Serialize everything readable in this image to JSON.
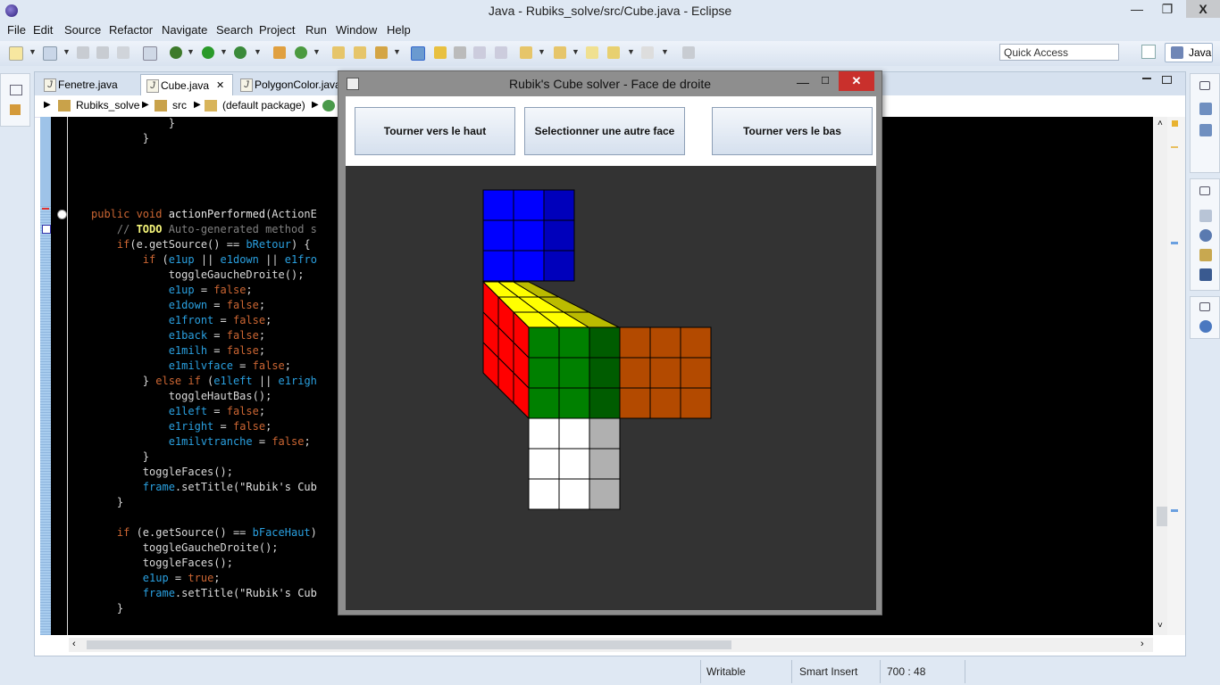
{
  "window": {
    "title": "Java - Rubiks_solve/src/Cube.java - Eclipse",
    "minimize": "—",
    "restore": "❐",
    "close": "X"
  },
  "menu": [
    "File",
    "Edit",
    "Source",
    "Refactor",
    "Navigate",
    "Search",
    "Project",
    "Run",
    "Window",
    "Help"
  ],
  "toolbar": {
    "quick_access": "Quick Access",
    "perspective": "Java"
  },
  "editor": {
    "tabs": [
      "Fenetre.java",
      "Cube.java",
      "PolygonColor.java"
    ],
    "active_tab": 1,
    "tab_close": "✕",
    "breadcrumb": [
      "Rubiks_solve",
      "src",
      "(default package)"
    ],
    "code_lines": [
      {
        "t": [
          [
            "            }",
            ""
          ]
        ]
      },
      {
        "t": [
          [
            "        }",
            ""
          ]
        ]
      },
      {
        "t": [
          [
            "",
            ""
          ]
        ]
      },
      {
        "t": [
          [
            "",
            ""
          ]
        ]
      },
      {
        "t": [
          [
            "",
            ""
          ]
        ]
      },
      {
        "t": [
          [
            "",
            ""
          ]
        ]
      },
      {
        "t": [
          [
            "public void ",
            "kw"
          ],
          [
            "actionPerformed",
            "fn"
          ],
          [
            "(ActionE",
            ""
          ]
        ]
      },
      {
        "t": [
          [
            "    // ",
            "cm"
          ],
          [
            "TODO",
            "todo"
          ],
          [
            " Auto-generated method s",
            "cm"
          ]
        ]
      },
      {
        "t": [
          [
            "    if",
            "kw"
          ],
          [
            "(e.getSource() == ",
            ""
          ],
          [
            "bRetour",
            "fld"
          ],
          [
            ") {",
            ""
          ]
        ]
      },
      {
        "t": [
          [
            "        if ",
            "kw"
          ],
          [
            "(",
            ""
          ],
          [
            "e1up",
            "fld"
          ],
          [
            " || ",
            ""
          ],
          [
            "e1down",
            "fld"
          ],
          [
            " || ",
            ""
          ],
          [
            "e1fro",
            "fld"
          ]
        ]
      },
      {
        "t": [
          [
            "            toggleGaucheDroite();",
            ""
          ]
        ]
      },
      {
        "t": [
          [
            "            ",
            ""
          ],
          [
            "e1up",
            "fld"
          ],
          [
            " = ",
            ""
          ],
          [
            "false",
            "kw"
          ],
          [
            ";",
            ""
          ]
        ]
      },
      {
        "t": [
          [
            "            ",
            ""
          ],
          [
            "e1down",
            "fld"
          ],
          [
            " = ",
            ""
          ],
          [
            "false",
            "kw"
          ],
          [
            ";",
            ""
          ]
        ]
      },
      {
        "t": [
          [
            "            ",
            ""
          ],
          [
            "e1front",
            "fld"
          ],
          [
            " = ",
            ""
          ],
          [
            "false",
            "kw"
          ],
          [
            ";",
            ""
          ]
        ]
      },
      {
        "t": [
          [
            "            ",
            ""
          ],
          [
            "e1back",
            "fld"
          ],
          [
            " = ",
            ""
          ],
          [
            "false",
            "kw"
          ],
          [
            ";",
            ""
          ]
        ]
      },
      {
        "t": [
          [
            "            ",
            ""
          ],
          [
            "e1milh",
            "fld"
          ],
          [
            " = ",
            ""
          ],
          [
            "false",
            "kw"
          ],
          [
            ";",
            ""
          ]
        ]
      },
      {
        "t": [
          [
            "            ",
            ""
          ],
          [
            "e1milvface",
            "fld"
          ],
          [
            " = ",
            ""
          ],
          [
            "false",
            "kw"
          ],
          [
            ";",
            ""
          ]
        ]
      },
      {
        "t": [
          [
            "        } ",
            ""
          ],
          [
            "else if ",
            "kw"
          ],
          [
            "(",
            ""
          ],
          [
            "e1left",
            "fld"
          ],
          [
            " || ",
            ""
          ],
          [
            "e1righ",
            "fld"
          ]
        ]
      },
      {
        "t": [
          [
            "            toggleHautBas();",
            ""
          ]
        ]
      },
      {
        "t": [
          [
            "            ",
            ""
          ],
          [
            "e1left",
            "fld"
          ],
          [
            " = ",
            ""
          ],
          [
            "false",
            "kw"
          ],
          [
            ";",
            ""
          ]
        ]
      },
      {
        "t": [
          [
            "            ",
            ""
          ],
          [
            "e1right",
            "fld"
          ],
          [
            " = ",
            ""
          ],
          [
            "false",
            "kw"
          ],
          [
            ";",
            ""
          ]
        ]
      },
      {
        "t": [
          [
            "            ",
            ""
          ],
          [
            "e1milvtranche",
            "fld"
          ],
          [
            " = ",
            ""
          ],
          [
            "false",
            "kw"
          ],
          [
            ";",
            ""
          ]
        ]
      },
      {
        "t": [
          [
            "        }",
            ""
          ]
        ]
      },
      {
        "t": [
          [
            "        toggleFaces();",
            ""
          ]
        ]
      },
      {
        "t": [
          [
            "        ",
            ""
          ],
          [
            "frame",
            "fld"
          ],
          [
            ".setTitle(",
            ""
          ],
          [
            "\"Rubik's Cub",
            "str"
          ]
        ]
      },
      {
        "t": [
          [
            "    }",
            ""
          ]
        ]
      },
      {
        "t": [
          [
            "",
            ""
          ]
        ]
      },
      {
        "t": [
          [
            "    if ",
            "kw"
          ],
          [
            "(e.getSource() == ",
            ""
          ],
          [
            "bFaceHaut",
            "fld"
          ],
          [
            ")",
            ""
          ]
        ]
      },
      {
        "t": [
          [
            "        toggleGaucheDroite();",
            ""
          ]
        ]
      },
      {
        "t": [
          [
            "        toggleFaces();",
            ""
          ]
        ]
      },
      {
        "t": [
          [
            "        ",
            ""
          ],
          [
            "e1up",
            "fld"
          ],
          [
            " = ",
            ""
          ],
          [
            "true",
            "kw"
          ],
          [
            ";",
            ""
          ]
        ]
      },
      {
        "t": [
          [
            "        ",
            ""
          ],
          [
            "frame",
            "fld"
          ],
          [
            ".setTitle(",
            ""
          ],
          [
            "\"Rubik's Cub",
            "str"
          ]
        ]
      },
      {
        "t": [
          [
            "    }",
            ""
          ]
        ]
      }
    ]
  },
  "status": {
    "writable": "Writable",
    "insert_mode": "Smart Insert",
    "position": "700 : 48"
  },
  "dialog": {
    "title": "Rubik's Cube solver - Face de droite",
    "min": "—",
    "max": "☐",
    "close": "✕",
    "buttons": [
      "Tourner vers le haut",
      "Selectionner une autre face",
      "Tourner vers le bas"
    ]
  },
  "cube": {
    "background": "#333333",
    "colors": {
      "blue": "#0000ff",
      "blue_dark": "#0000bb",
      "yellow": "#ffff00",
      "yellow_dark": "#bbbb00",
      "red": "#ff0000",
      "green": "#008000",
      "green_dark": "#005c00",
      "orange": "#b34a00",
      "white": "#ffffff",
      "white_dark": "#b0b0b0"
    }
  }
}
